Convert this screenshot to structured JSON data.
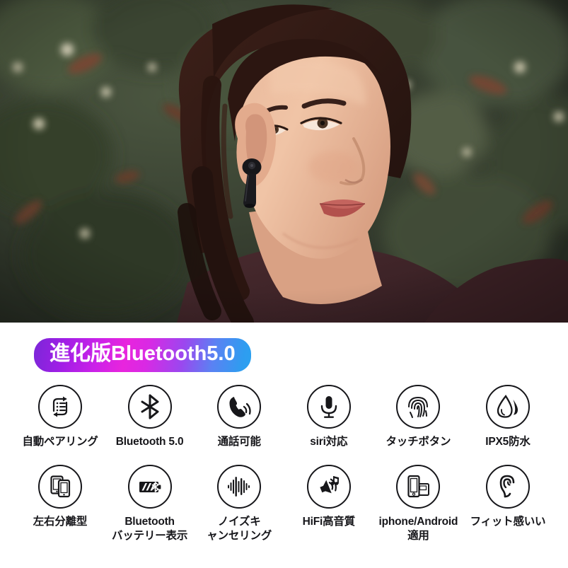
{
  "hero": {
    "alt": "woman outdoors wearing black wireless earbud, looking up, green foliage background",
    "earbud_color": "#1a1a1c",
    "shirt_color": "#41262a",
    "foliage_color": "#3c4434"
  },
  "banner": {
    "text": "進化版Bluetooth5.0",
    "gradient_from": "#7b27d8",
    "gradient_mid": "#e825dd",
    "gradient_to": "#2aa2ef",
    "text_color": "#ffffff"
  },
  "features": {
    "row1": [
      {
        "icon": "auto-pairing-icon",
        "label": "自動ペアリング"
      },
      {
        "icon": "bluetooth-icon",
        "label": "Bluetooth 5.0"
      },
      {
        "icon": "phone-call-icon",
        "label": "通話可能"
      },
      {
        "icon": "microphone-icon",
        "label": "siri対応"
      },
      {
        "icon": "fingerprint-icon",
        "label": "タッチボタン"
      },
      {
        "icon": "water-drop-icon",
        "label": "IPX5防水"
      }
    ],
    "row2": [
      {
        "icon": "two-phones-icon",
        "label": "左右分離型"
      },
      {
        "icon": "bluetooth-battery-icon",
        "label": "Bluetooth\nバッテリー表示"
      },
      {
        "icon": "waveform-icon",
        "label": "ノイズキ\nャンセリング"
      },
      {
        "icon": "speaker-music-icon",
        "label": "HiFi高音質"
      },
      {
        "icon": "phone-device-icon",
        "label": "iphone/Android\n適用"
      },
      {
        "icon": "ear-icon",
        "label": "フィット感いい"
      }
    ]
  }
}
